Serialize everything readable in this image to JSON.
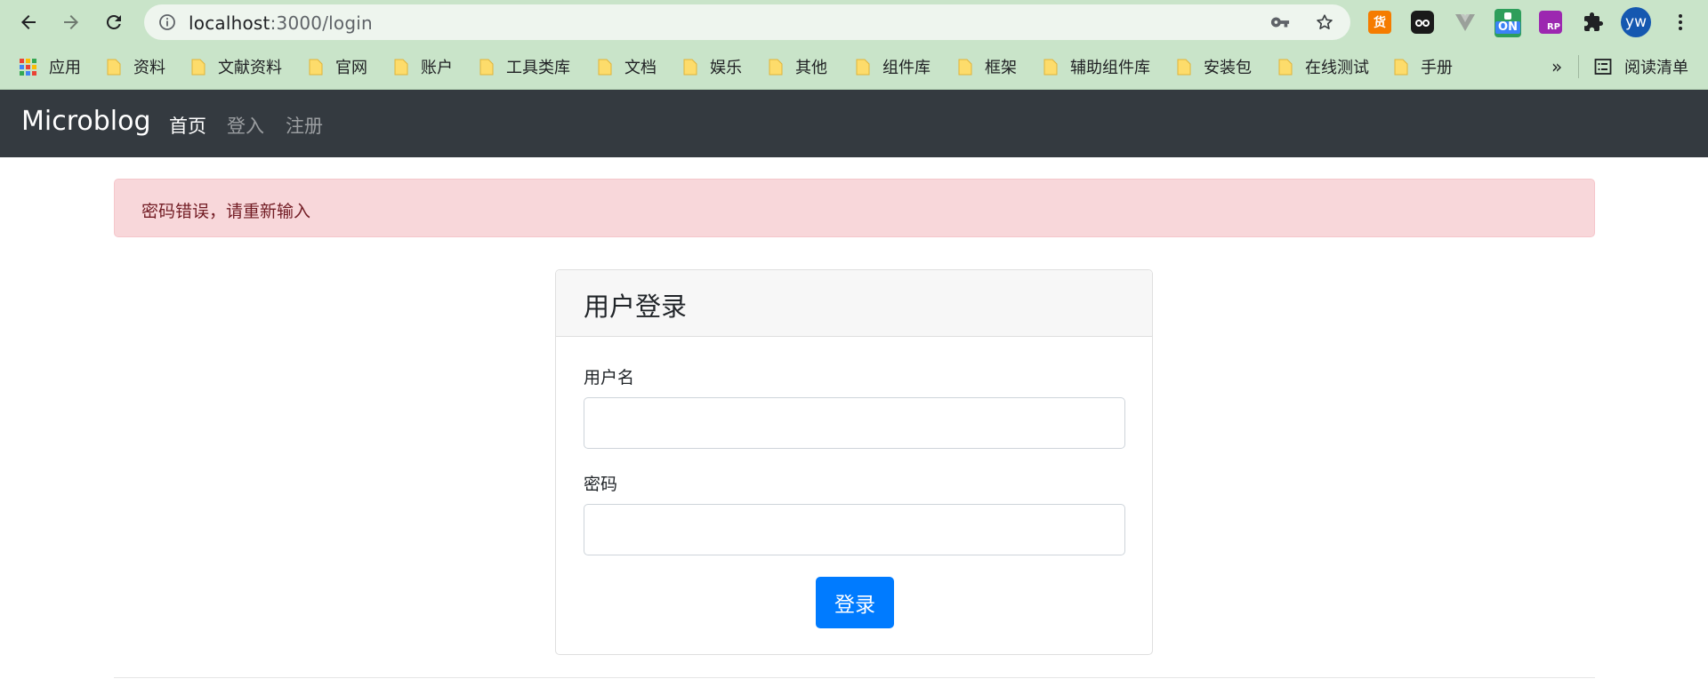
{
  "browser": {
    "url_host": "localhost",
    "url_path": ":3000/login",
    "icons": {
      "back": "arrow-left-icon",
      "forward": "arrow-right-icon",
      "reload": "reload-icon",
      "site_info": "info-icon",
      "password_key": "key-icon",
      "bookmark_star": "star-icon",
      "extensions": "puzzle-icon",
      "menu": "kebab-menu-icon"
    },
    "extensions": [
      {
        "label": "货",
        "color": "#f57c00"
      },
      {
        "label": "",
        "color": "#1a1a1a"
      },
      {
        "label": "",
        "color": "#8c8c8c"
      },
      {
        "label": "ON",
        "color": "#2e9e5b"
      },
      {
        "label": "RP",
        "color": "#9c27b0"
      }
    ],
    "profile_initials": "yw",
    "profile_color": "#1558b0",
    "bookmarks": {
      "apps_label": "应用",
      "items": [
        "资料",
        "文献资料",
        "官网",
        "账户",
        "工具类库",
        "文档",
        "娱乐",
        "其他",
        "组件库",
        "框架",
        "辅助组件库",
        "安装包",
        "在线测试",
        "手册"
      ],
      "overflow": "»",
      "reading_list": "阅读清单"
    }
  },
  "site": {
    "brand": "Microblog",
    "nav": {
      "home": "首页",
      "login": "登入",
      "register": "注册"
    },
    "alert": {
      "message": "密码错误，请重新输入",
      "color": "#f8d7da"
    },
    "login_card": {
      "title": "用户登录",
      "username_label": "用户名",
      "username_value": "",
      "password_label": "密码",
      "password_value": "",
      "submit_label": "登录",
      "accent": "#007bff"
    }
  }
}
